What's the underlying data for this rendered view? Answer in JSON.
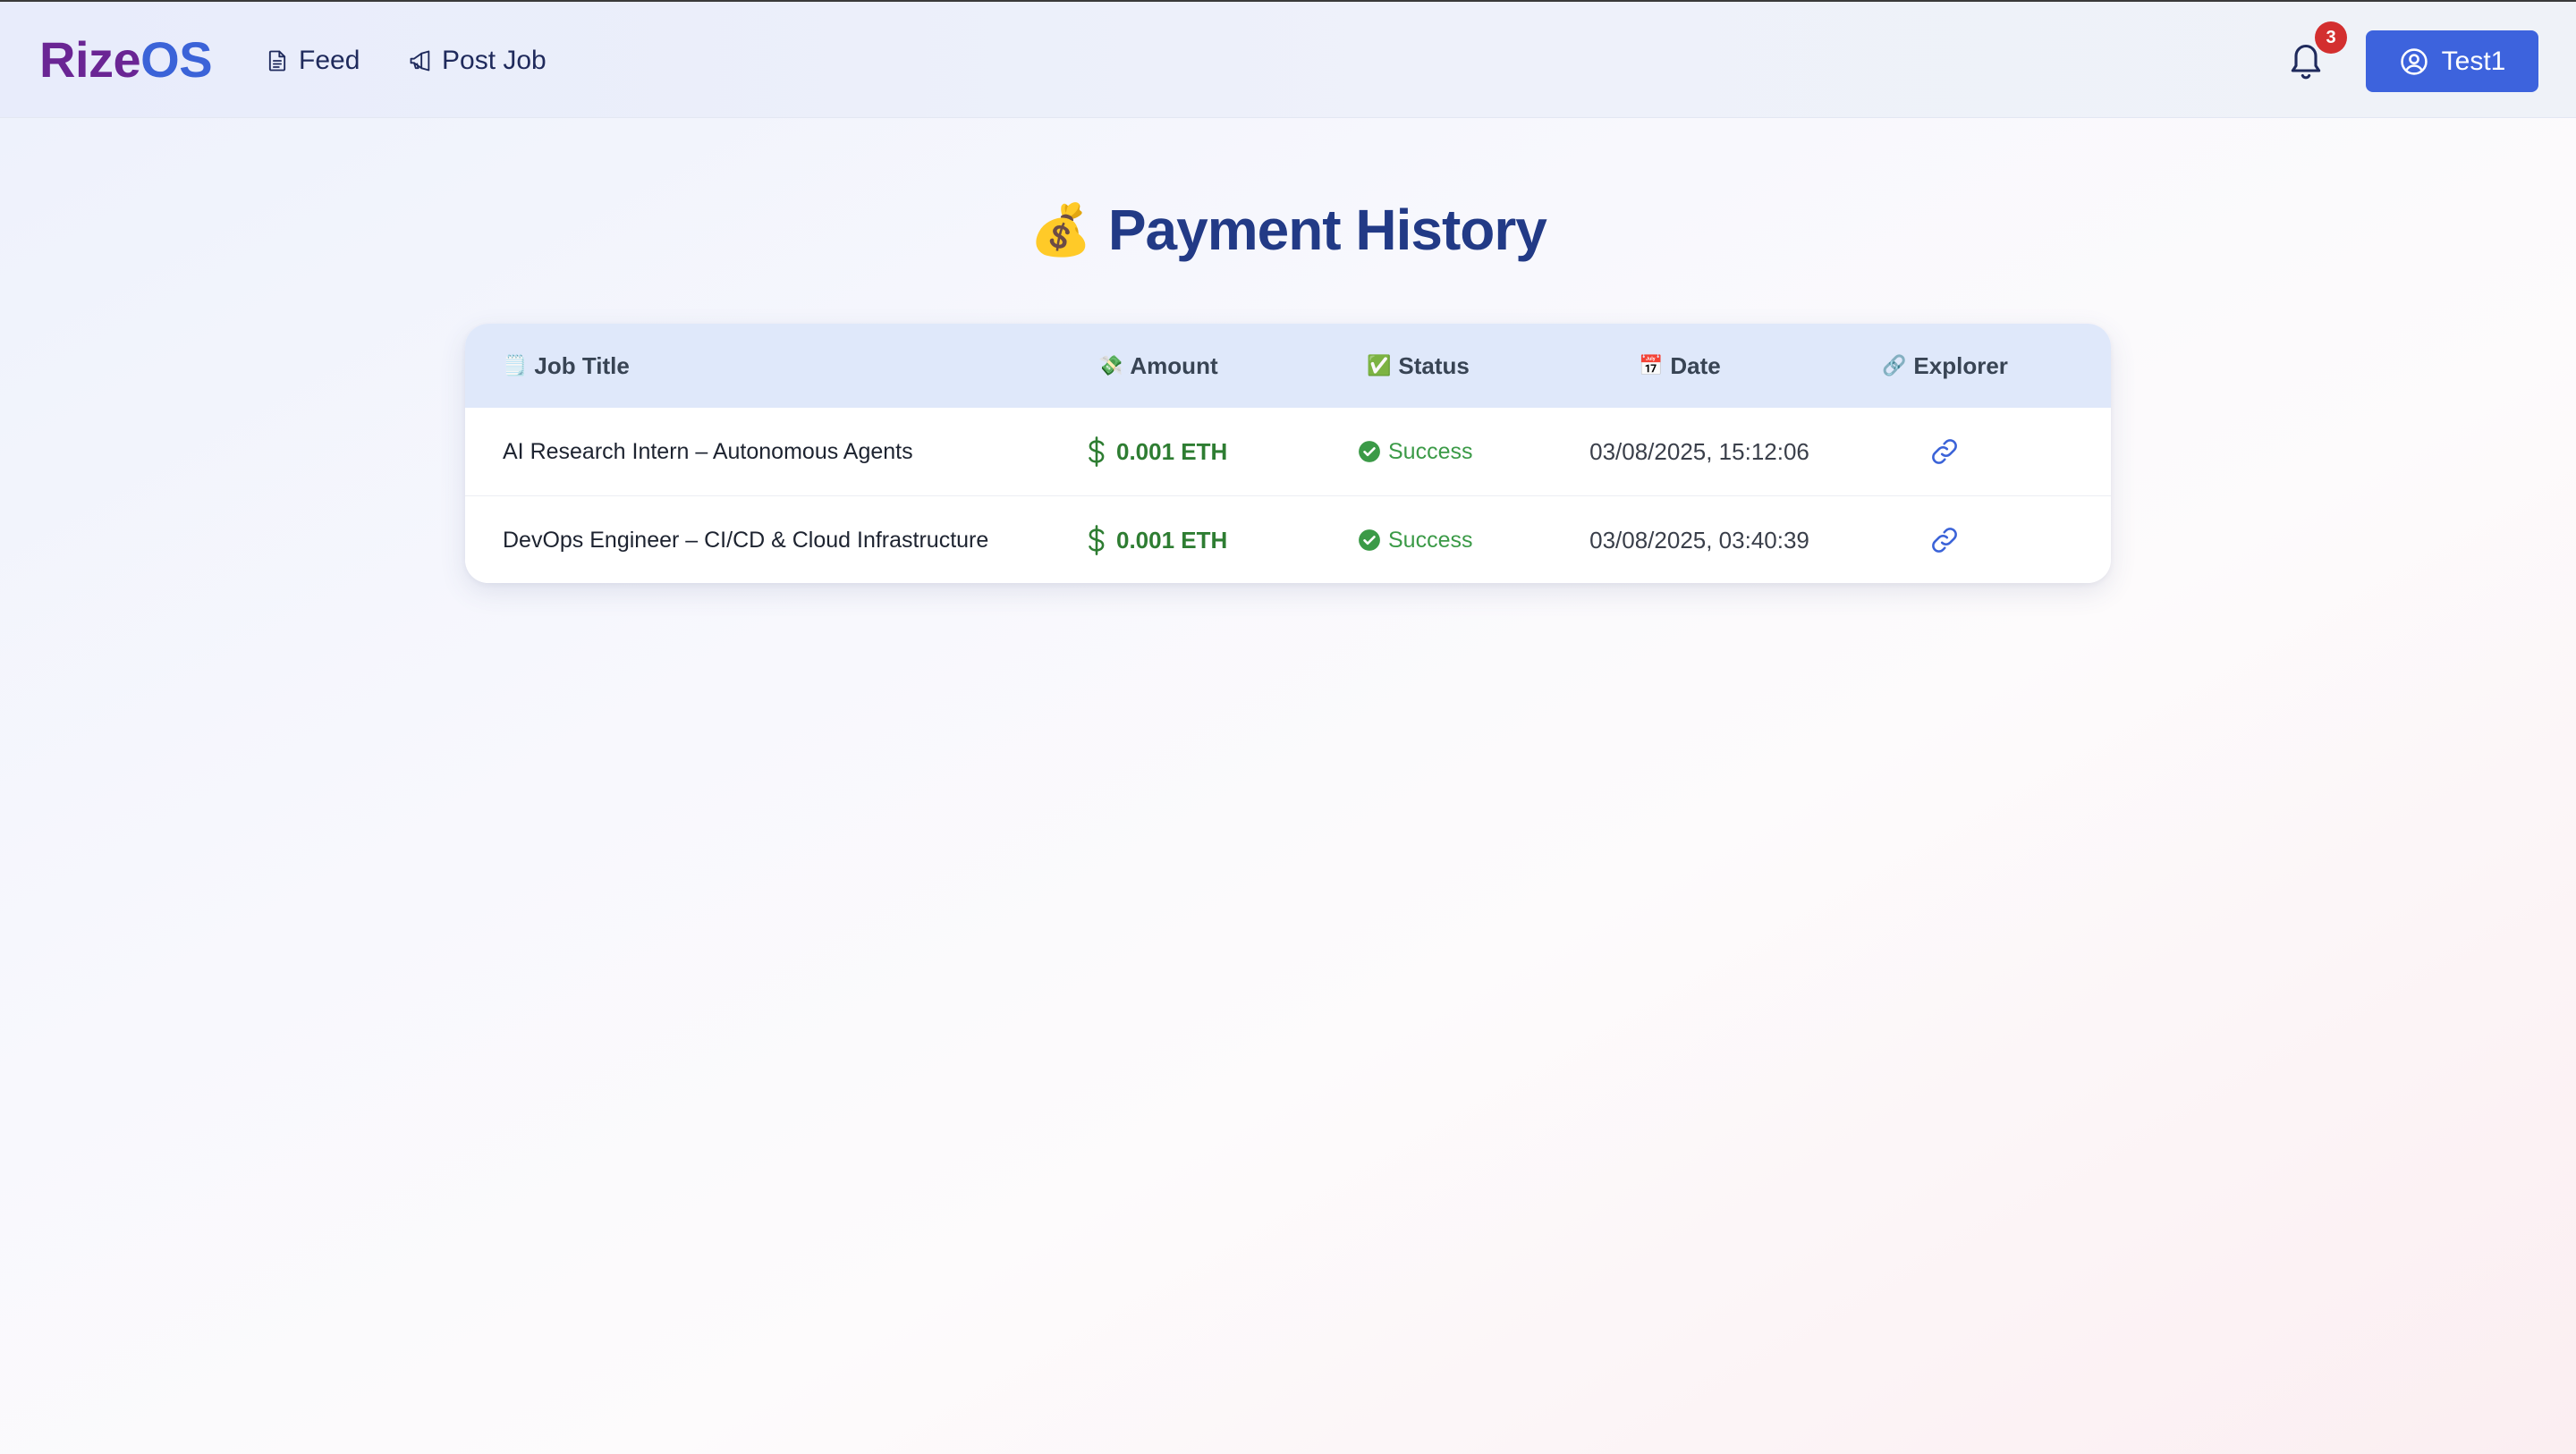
{
  "navbar": {
    "brand_part1": "Rize",
    "brand_part2": "OS",
    "links": [
      {
        "label": "Feed",
        "icon": "document-icon"
      },
      {
        "label": "Post Job",
        "icon": "megaphone-icon"
      }
    ],
    "notification_count": "3",
    "user_label": "Test1"
  },
  "page": {
    "title_emoji": "💰",
    "title": "Payment History"
  },
  "table": {
    "columns": [
      {
        "icon": "🗒️",
        "label": "Job Title"
      },
      {
        "icon": "💸",
        "label": "Amount"
      },
      {
        "icon": "✅",
        "label": "Status"
      },
      {
        "icon": "📅",
        "label": "Date"
      },
      {
        "icon": "🔗",
        "label": "Explorer"
      }
    ],
    "rows": [
      {
        "job_title": "AI Research Intern – Autonomous Agents",
        "amount": "0.001 ETH",
        "status": "Success",
        "date": "03/08/2025, 15:12:06"
      },
      {
        "job_title": "DevOps Engineer – CI/CD & Cloud Infrastructure",
        "amount": "0.001 ETH",
        "status": "Success",
        "date": "03/08/2025, 03:40:39"
      }
    ]
  },
  "colors": {
    "brand_purple": "#6a2594",
    "brand_blue": "#3b63d8",
    "primary_button": "#3d63dd",
    "title": "#223a86",
    "amount_green": "#2e7d32",
    "success_green": "#3b9a47",
    "badge_red": "#d32f2f",
    "table_header_bg": "#dfe8fa"
  }
}
